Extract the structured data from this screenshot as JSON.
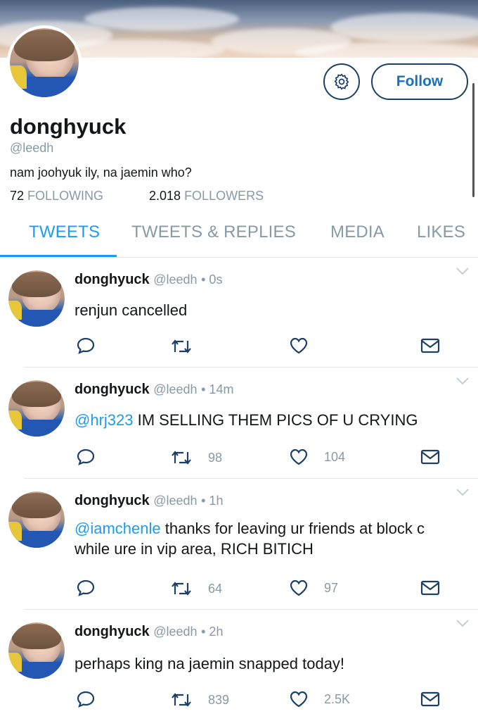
{
  "profile": {
    "name": "donghyuck",
    "handle": "@leedh",
    "bio": "nam joohyuk ily, na jaemin who?",
    "following_count": "72",
    "following_label": "FOLLOWING",
    "followers_count": "2.018",
    "followers_label": "FOLLOWERS",
    "follow_label": "Follow",
    "settings_icon": "gear-icon"
  },
  "tabs": [
    {
      "label": "TWEETS",
      "active": true
    },
    {
      "label": "TWEETS & REPLIES",
      "active": false
    },
    {
      "label": "MEDIA",
      "active": false
    },
    {
      "label": "LIKES",
      "active": false
    }
  ],
  "tweets": [
    {
      "name": "donghyuck",
      "handle": "@leedh",
      "time": "• 0s",
      "mention": "",
      "text": "renjun cancelled",
      "text2": "",
      "retweets": "",
      "likes": ""
    },
    {
      "name": "donghyuck",
      "handle": "@leedh",
      "time": "• 14m",
      "mention": "@hrj323",
      "text": " IM SELLING THEM PICS OF U CRYING",
      "text2": "",
      "retweets": "98",
      "likes": "104"
    },
    {
      "name": "donghyuck",
      "handle": "@leedh",
      "time": "• 1h",
      "mention": "@iamchenle",
      "text": " thanks for leaving ur friends at block c",
      "text2": "while ure in vip area, RICH BITICH",
      "retweets": "64",
      "likes": "97"
    },
    {
      "name": "donghyuck",
      "handle": "@leedh",
      "time": "• 2h",
      "mention": "",
      "text": "perhaps king na jaemin snapped today!",
      "text2": "",
      "retweets": "839",
      "likes": "2.5K"
    }
  ],
  "colors": {
    "accent": "#1d9bf0",
    "muted": "#8899a6",
    "text": "#14171a",
    "button_border": "#1c3f66"
  }
}
